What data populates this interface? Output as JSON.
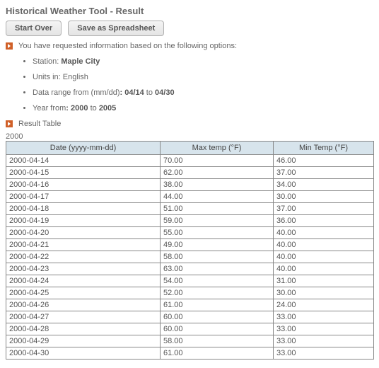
{
  "title": "Historical Weather Tool - Result",
  "buttons": {
    "start_over": "Start Over",
    "save_spreadsheet": "Save as Spreadsheet"
  },
  "request_line": "You have requested information based on the following options:",
  "options": {
    "station_label": "Station: ",
    "station_value": "Maple City",
    "units_label": "Units in: ",
    "units_value": "English",
    "range_label": "Data range from (mm/dd)",
    "range_from": "04/14",
    "range_to": "04/30",
    "year_label": "Year from",
    "year_from": "2000",
    "year_to": "2005",
    "sep_colon": ": ",
    "sep_to": " to "
  },
  "result_table_label": "Result Table",
  "table": {
    "year_heading": "2000",
    "headers": [
      "Date (yyyy-mm-dd)",
      "Max temp (°F)",
      "Min Temp (°F)"
    ],
    "rows": [
      [
        "2000-04-14",
        "70.00",
        "46.00"
      ],
      [
        "2000-04-15",
        "62.00",
        "37.00"
      ],
      [
        "2000-04-16",
        "38.00",
        "34.00"
      ],
      [
        "2000-04-17",
        "44.00",
        "30.00"
      ],
      [
        "2000-04-18",
        "51.00",
        "37.00"
      ],
      [
        "2000-04-19",
        "59.00",
        "36.00"
      ],
      [
        "2000-04-20",
        "55.00",
        "40.00"
      ],
      [
        "2000-04-21",
        "49.00",
        "40.00"
      ],
      [
        "2000-04-22",
        "58.00",
        "40.00"
      ],
      [
        "2000-04-23",
        "63.00",
        "40.00"
      ],
      [
        "2000-04-24",
        "54.00",
        "31.00"
      ],
      [
        "2000-04-25",
        "52.00",
        "30.00"
      ],
      [
        "2000-04-26",
        "61.00",
        "24.00"
      ],
      [
        "2000-04-27",
        "60.00",
        "33.00"
      ],
      [
        "2000-04-28",
        "60.00",
        "33.00"
      ],
      [
        "2000-04-29",
        "58.00",
        "33.00"
      ],
      [
        "2000-04-30",
        "61.00",
        "33.00"
      ]
    ]
  }
}
